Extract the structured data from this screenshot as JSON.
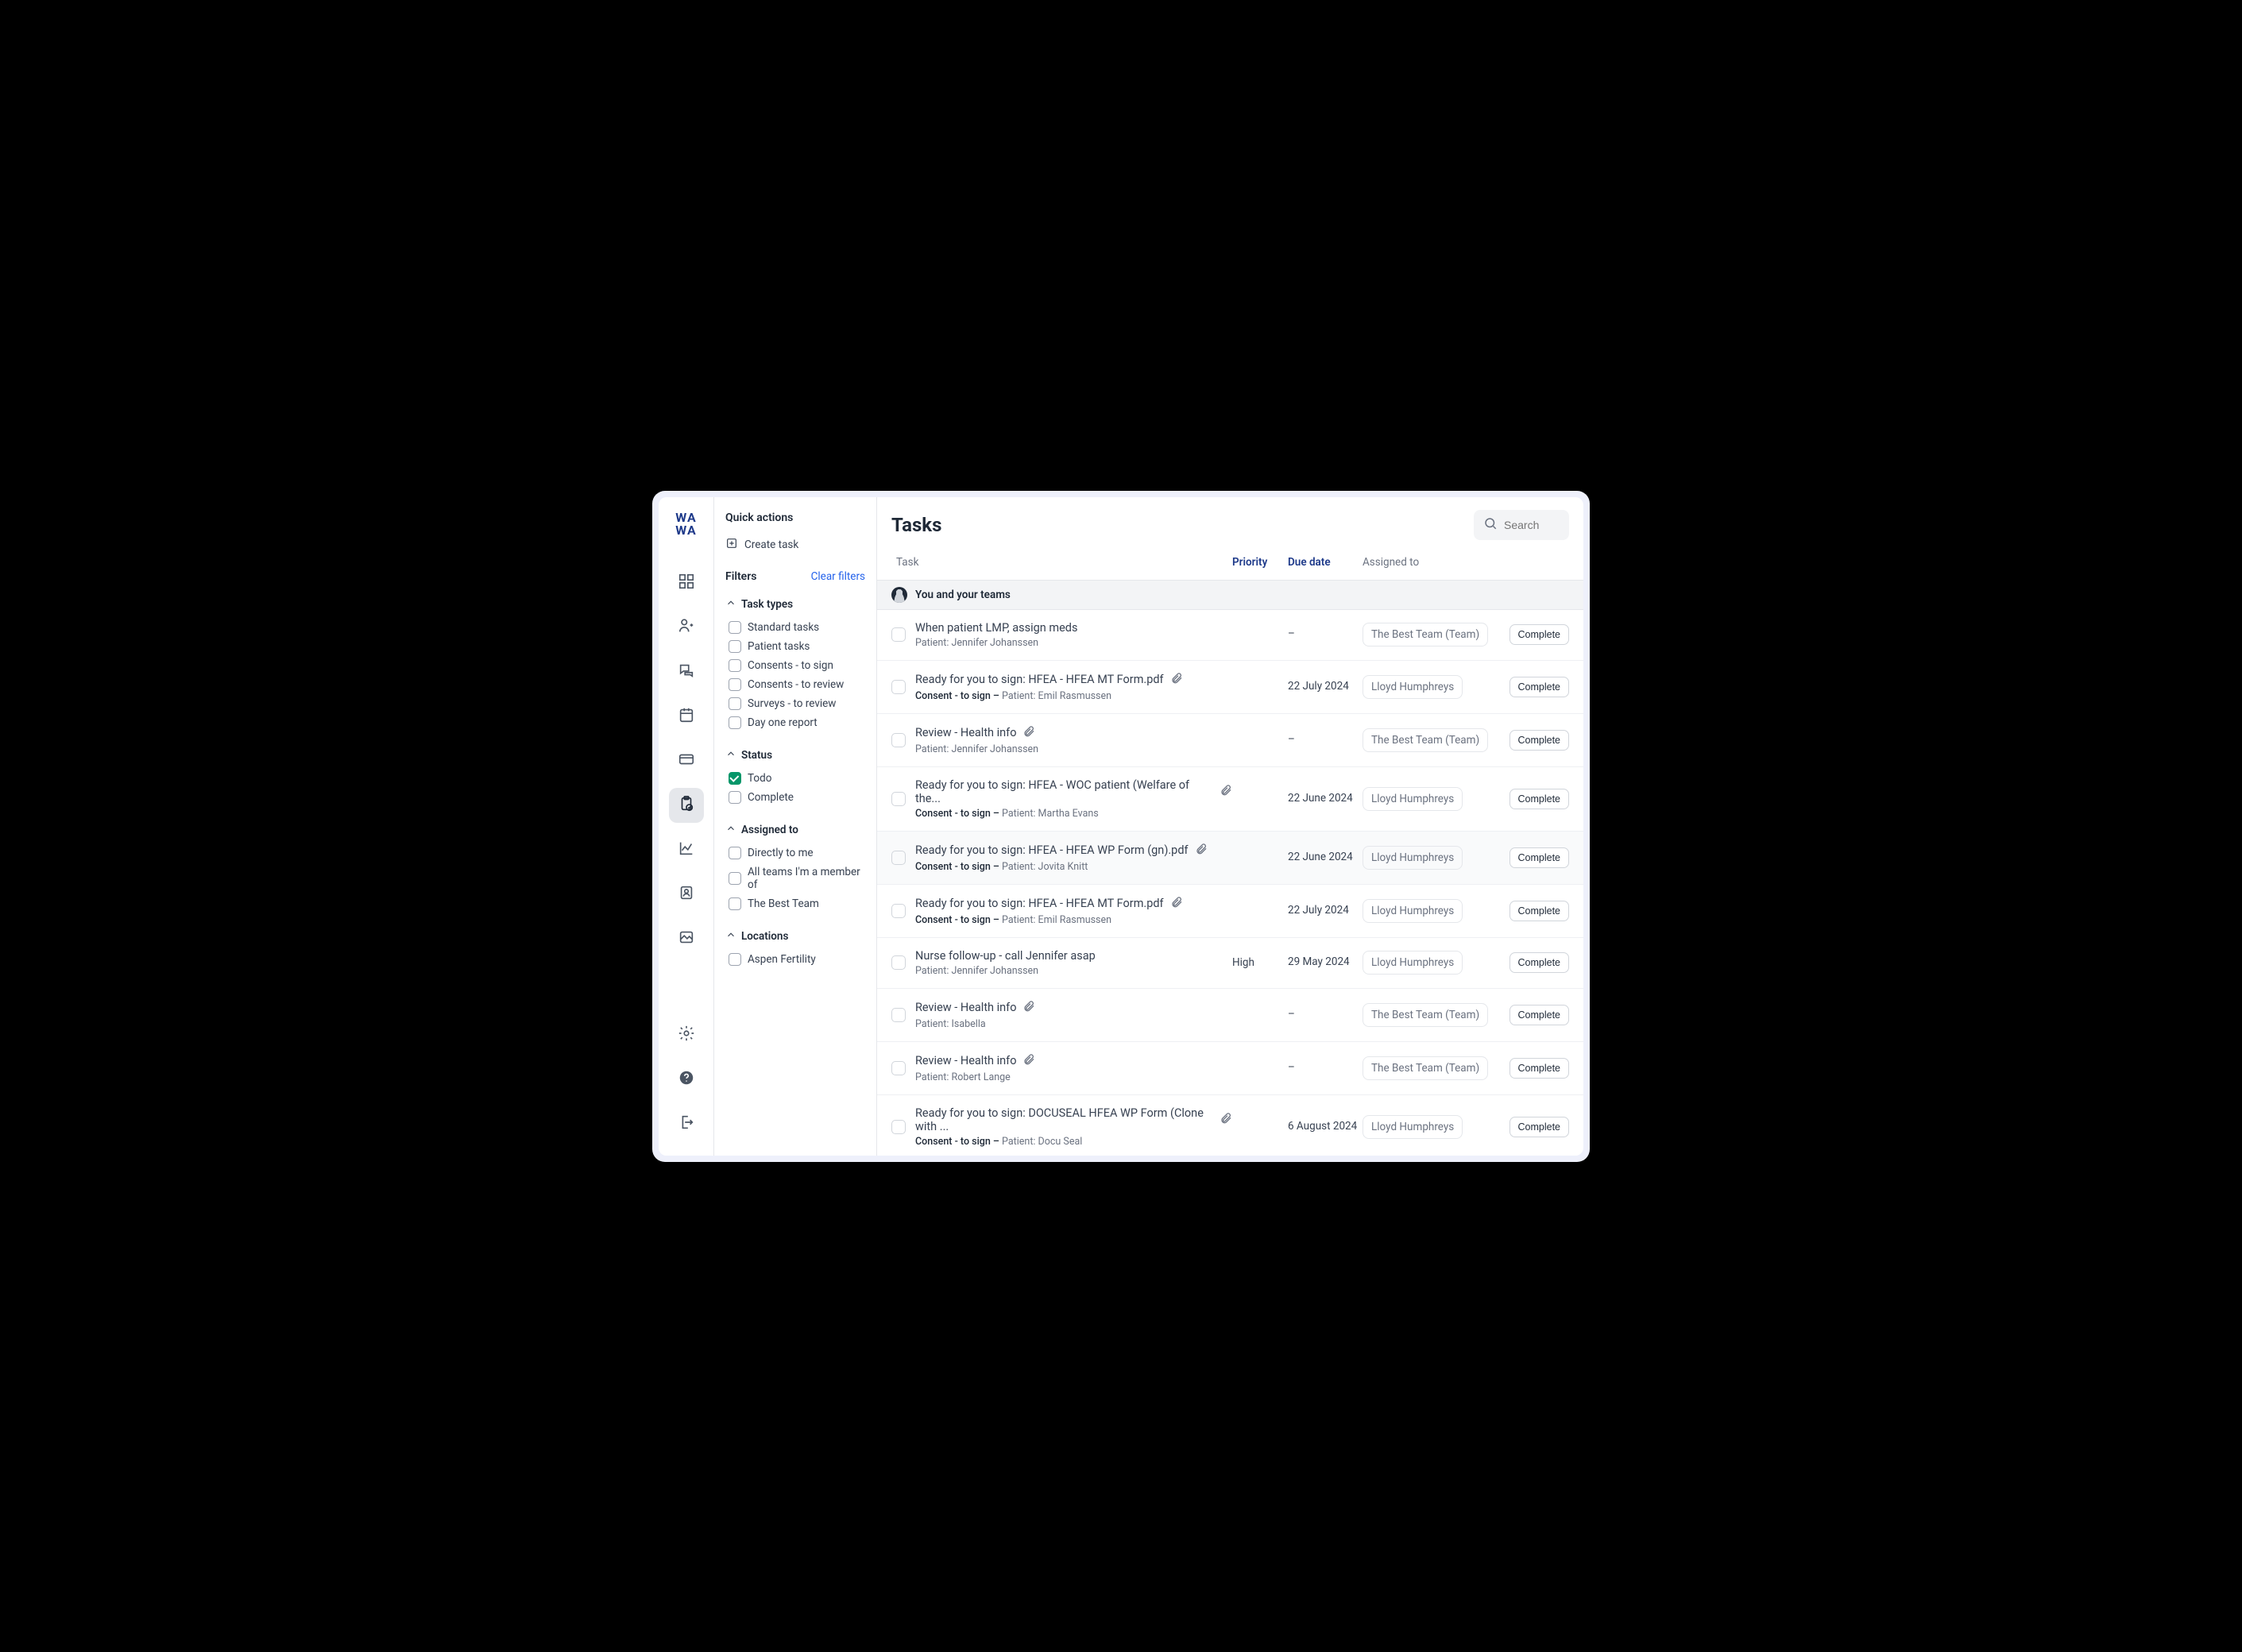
{
  "logo": {
    "line1": "WA",
    "line2": "WA"
  },
  "sidebar": {
    "quick_actions_title": "Quick actions",
    "create_task_label": "Create task",
    "filters_title": "Filters",
    "clear_filters_label": "Clear filters",
    "sections": {
      "task_types": {
        "title": "Task types",
        "items": [
          "Standard tasks",
          "Patient tasks",
          "Consents - to sign",
          "Consents - to review",
          "Surveys - to review",
          "Day one report"
        ]
      },
      "status": {
        "title": "Status",
        "items": [
          {
            "label": "Todo",
            "checked": true
          },
          {
            "label": "Complete",
            "checked": false
          }
        ]
      },
      "assigned_to": {
        "title": "Assigned to",
        "items": [
          "Directly to me",
          "All teams I'm a member of",
          "The Best Team"
        ]
      },
      "locations": {
        "title": "Locations",
        "items": [
          "Aspen Fertility"
        ]
      }
    }
  },
  "main": {
    "title": "Tasks",
    "search_placeholder": "Search",
    "columns": {
      "task": "Task",
      "priority": "Priority",
      "due": "Due date",
      "assigned": "Assigned to"
    },
    "group_label": "You and your teams",
    "complete_btn": "Complete",
    "tasks": [
      {
        "title": "When patient LMP, assign meds",
        "subtitle": "Patient: Jennifer Johanssen",
        "badge": "",
        "attachment": false,
        "priority": "",
        "due": "–",
        "assignee": "The Best Team (Team)",
        "selected": false
      },
      {
        "title": "Ready for you to sign: HFEA - HFEA MT Form.pdf",
        "subtitle": "Patient: Emil Rasmussen",
        "badge": "Consent - to sign – ",
        "attachment": true,
        "priority": "",
        "due": "22 July 2024",
        "assignee": "Lloyd Humphreys",
        "selected": false
      },
      {
        "title": "Review - Health info",
        "subtitle": "Patient: Jennifer Johanssen",
        "badge": "",
        "attachment": true,
        "priority": "",
        "due": "–",
        "assignee": "The Best Team (Team)",
        "selected": false
      },
      {
        "title": "Ready for you to sign: HFEA - WOC patient (Welfare of the...",
        "subtitle": "Patient: Martha Evans",
        "badge": "Consent - to sign – ",
        "attachment": true,
        "priority": "",
        "due": "22 June 2024",
        "assignee": "Lloyd Humphreys",
        "selected": false
      },
      {
        "title": "Ready for you to sign: HFEA - HFEA WP Form (gn).pdf",
        "subtitle": "Patient: Jovita Knitt",
        "badge": "Consent - to sign – ",
        "attachment": true,
        "priority": "",
        "due": "22 June 2024",
        "assignee": "Lloyd Humphreys",
        "selected": true
      },
      {
        "title": "Ready for you to sign: HFEA - HFEA MT Form.pdf",
        "subtitle": "Patient: Emil Rasmussen",
        "badge": "Consent - to sign – ",
        "attachment": true,
        "priority": "",
        "due": "22 July 2024",
        "assignee": "Lloyd Humphreys",
        "selected": false
      },
      {
        "title": "Nurse follow-up - call Jennifer asap",
        "subtitle": "Patient: Jennifer Johanssen",
        "badge": "",
        "attachment": false,
        "priority": "High",
        "due": "29 May 2024",
        "assignee": "Lloyd Humphreys",
        "selected": false
      },
      {
        "title": "Review - Health info",
        "subtitle": "Patient: Isabella",
        "badge": "",
        "attachment": true,
        "priority": "",
        "due": "–",
        "assignee": "The Best Team (Team)",
        "selected": false
      },
      {
        "title": "Review - Health info",
        "subtitle": "Patient: Robert Lange",
        "badge": "",
        "attachment": true,
        "priority": "",
        "due": "–",
        "assignee": "The Best Team (Team)",
        "selected": false
      },
      {
        "title": "Ready for you to sign: DOCUSEAL HFEA WP Form (Clone with ...",
        "subtitle": "Patient: Docu Seal",
        "badge": "Consent - to sign – ",
        "attachment": true,
        "priority": "",
        "due": "6 August 2024",
        "assignee": "Lloyd Humphreys",
        "selected": false
      }
    ]
  }
}
